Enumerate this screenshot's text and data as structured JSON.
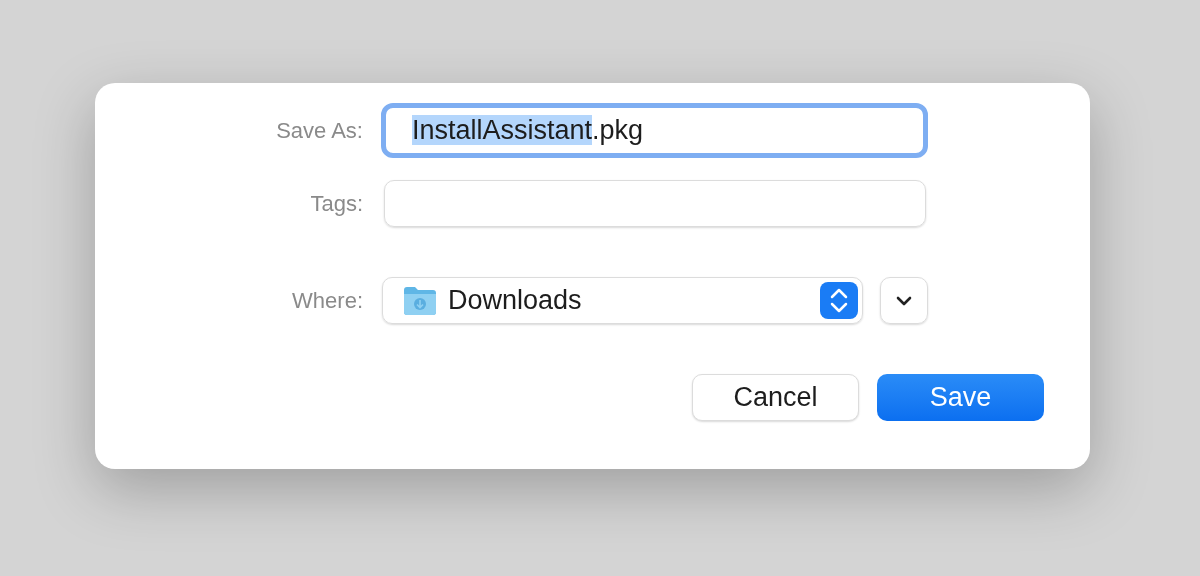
{
  "dialog": {
    "save_as": {
      "label": "Save As:",
      "value_selected": "InstallAssistant",
      "value_rest": ".pkg",
      "focused": true
    },
    "tags": {
      "label": "Tags:"
    },
    "where": {
      "label": "Where:",
      "value": "Downloads",
      "expanded": false
    },
    "buttons": [
      {
        "label": "Cancel",
        "kind": "secondary"
      },
      {
        "label": "Save",
        "kind": "primary"
      }
    ]
  }
}
